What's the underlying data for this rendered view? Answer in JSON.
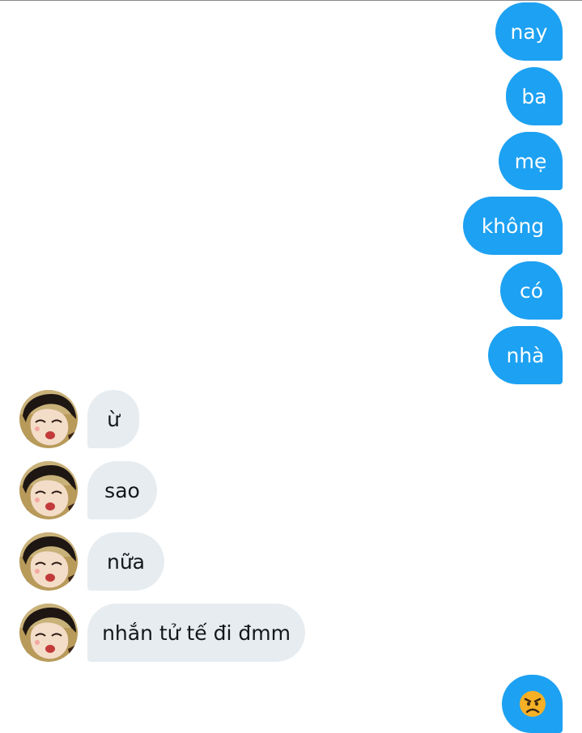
{
  "conversation": {
    "outgoing": [
      {
        "text": "nay"
      },
      {
        "text": "ba"
      },
      {
        "text": "mẹ"
      },
      {
        "text": "không"
      },
      {
        "text": "có"
      },
      {
        "text": "nhà"
      }
    ],
    "incoming": [
      {
        "text": "ừ"
      },
      {
        "text": "sao"
      },
      {
        "text": "nữa"
      },
      {
        "text": "nhắn tử tế đi đmm"
      }
    ],
    "last_outgoing": {
      "icon": "angry-face-icon"
    }
  },
  "colors": {
    "outgoing_bubble": "#1da1f2",
    "incoming_bubble": "#e6ecf0",
    "incoming_text": "#14171a",
    "angry_face": "#f5b026"
  }
}
